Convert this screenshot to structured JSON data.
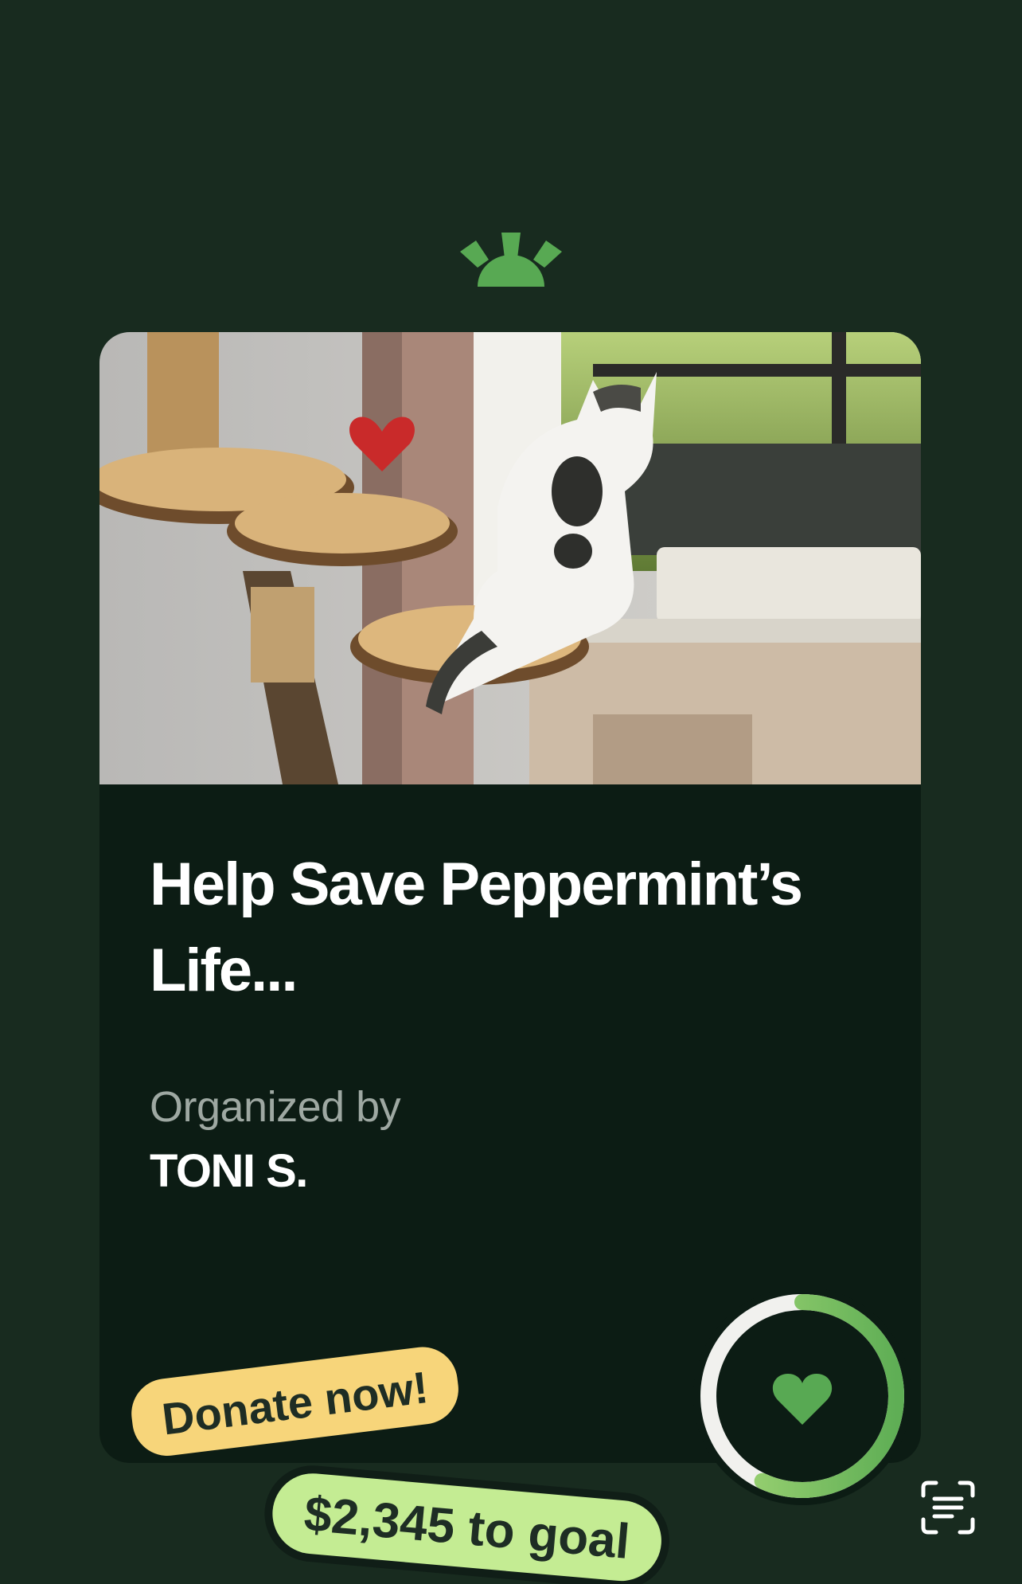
{
  "logo": {
    "icon": "gofundme-sun-icon",
    "color": "#58a953"
  },
  "campaign": {
    "photo": "cat-on-scratching-tree-photo",
    "title": "Help Save Peppermint’s Life...",
    "organized_label": "Organized by",
    "organizer": "TONI S."
  },
  "progress": {
    "fraction": 0.57,
    "icon": "heart-icon",
    "color": "#71c05b"
  },
  "donate_tag": "Donate now!",
  "goal_tag": "$2,345 to goal",
  "scan_button": {
    "icon": "scan-text-icon"
  }
}
